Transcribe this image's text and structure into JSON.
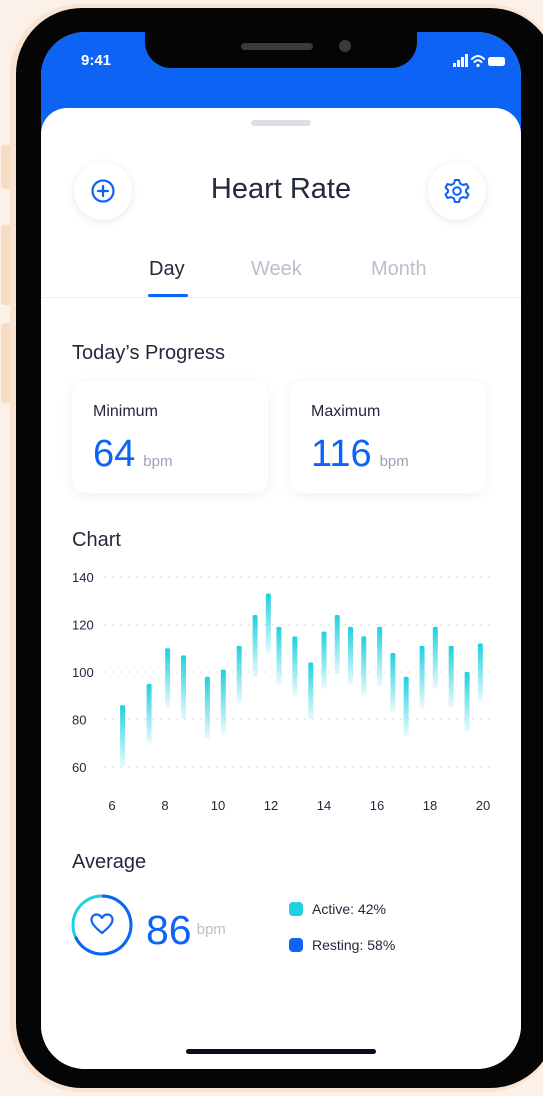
{
  "status_bar": {
    "time": "9:41"
  },
  "header": {
    "title": "Heart Rate",
    "add_icon": "plus-circle-icon",
    "settings_icon": "gear-icon"
  },
  "tabs": [
    {
      "label": "Day",
      "active": true
    },
    {
      "label": "Week",
      "active": false
    },
    {
      "label": "Month",
      "active": false
    }
  ],
  "progress": {
    "title": "Today’s Progress",
    "minimum": {
      "label": "Minimum",
      "value": "64",
      "unit": "bpm"
    },
    "maximum": {
      "label": "Maximum",
      "value": "116",
      "unit": "bpm"
    }
  },
  "chart_section": {
    "title": "Chart"
  },
  "chart_data": {
    "type": "bar",
    "ylim": [
      60,
      140
    ],
    "yticks": [
      "140",
      "120",
      "100",
      "80",
      "60"
    ],
    "xlim": [
      6,
      20
    ],
    "xticks": [
      "6",
      "8",
      "10",
      "12",
      "14",
      "16",
      "18",
      "20"
    ],
    "grid": true,
    "bars": [
      {
        "x": 6.4,
        "low": 60,
        "high": 86
      },
      {
        "x": 7.4,
        "low": 70,
        "high": 95
      },
      {
        "x": 8.1,
        "low": 85,
        "high": 110
      },
      {
        "x": 8.7,
        "low": 80,
        "high": 107
      },
      {
        "x": 9.6,
        "low": 72,
        "high": 98
      },
      {
        "x": 10.2,
        "low": 74,
        "high": 101
      },
      {
        "x": 10.8,
        "low": 87,
        "high": 111
      },
      {
        "x": 11.4,
        "low": 98,
        "high": 124
      },
      {
        "x": 11.9,
        "low": 108,
        "high": 133
      },
      {
        "x": 12.3,
        "low": 95,
        "high": 119
      },
      {
        "x": 12.9,
        "low": 90,
        "high": 115
      },
      {
        "x": 13.5,
        "low": 80,
        "high": 104
      },
      {
        "x": 14.0,
        "low": 93,
        "high": 117
      },
      {
        "x": 14.5,
        "low": 99,
        "high": 124
      },
      {
        "x": 15.0,
        "low": 95,
        "high": 119
      },
      {
        "x": 15.5,
        "low": 90,
        "high": 115
      },
      {
        "x": 16.1,
        "low": 94,
        "high": 119
      },
      {
        "x": 16.6,
        "low": 83,
        "high": 108
      },
      {
        "x": 17.1,
        "low": 73,
        "high": 98
      },
      {
        "x": 17.7,
        "low": 85,
        "high": 111
      },
      {
        "x": 18.2,
        "low": 93,
        "high": 119
      },
      {
        "x": 18.8,
        "low": 85,
        "high": 111
      },
      {
        "x": 19.4,
        "low": 75,
        "high": 100
      },
      {
        "x": 19.9,
        "low": 88,
        "high": 112
      }
    ]
  },
  "average": {
    "title": "Average",
    "value": "86",
    "unit": "bpm",
    "icon": "heart-icon",
    "legend": [
      {
        "label": "Active: 42%",
        "color": "#1fd0df"
      },
      {
        "label": "Resting: 58%",
        "color": "#0c63f4"
      }
    ]
  }
}
